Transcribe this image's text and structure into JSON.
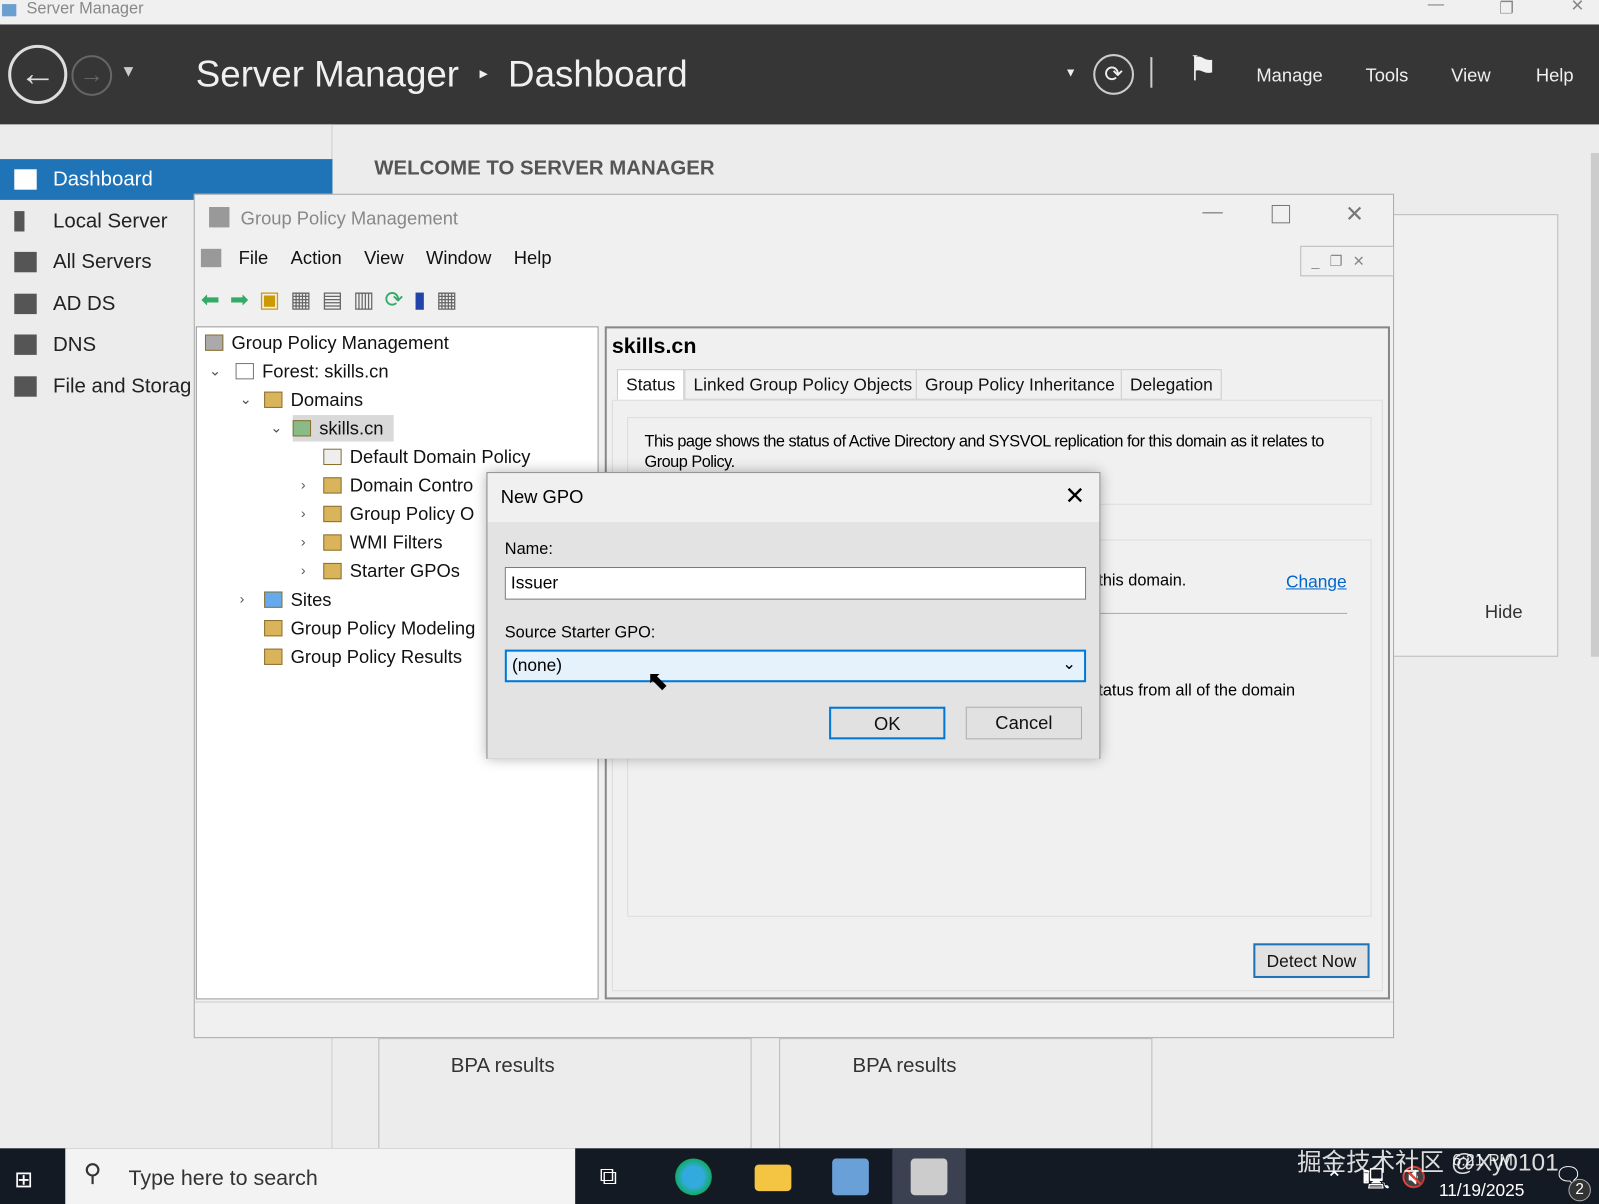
{
  "window": {
    "title": "Server Manager"
  },
  "header": {
    "breadcrumb_root": "Server Manager",
    "breadcrumb_sep": "▸",
    "breadcrumb_page": "Dashboard",
    "menu": [
      "Manage",
      "Tools",
      "View",
      "Help"
    ]
  },
  "sidebar": {
    "items": [
      {
        "label": "Dashboard",
        "active": true
      },
      {
        "label": "Local Server"
      },
      {
        "label": "All Servers"
      },
      {
        "label": "AD DS"
      },
      {
        "label": "DNS"
      },
      {
        "label": "File and Storag"
      }
    ]
  },
  "main": {
    "welcome": "WELCOME TO SERVER MANAGER",
    "hide": "Hide",
    "bpa1": "BPA results",
    "bpa2": "BPA results"
  },
  "gpm": {
    "title": "Group Policy Management",
    "menu": [
      "File",
      "Action",
      "View",
      "Window",
      "Help"
    ],
    "tree": [
      "Group Policy Management",
      "Forest: skills.cn",
      "Domains",
      "skills.cn",
      "Default Domain Policy",
      "Domain Contro",
      "Group Policy O",
      "WMI Filters",
      "Starter GPOs",
      "Sites",
      "Group Policy Modeling",
      "Group Policy Results"
    ],
    "pane_title": "skills.cn",
    "tabs": [
      "Status",
      "Linked Group Policy Objects",
      "Group Policy Inheritance",
      "Delegation"
    ],
    "status_text": "This page shows the status of Active Directory and SYSVOL replication for this domain as it relates to Group Policy.",
    "partial1": "this domain.",
    "change_link": "Change",
    "partial2": "tatus from all of the domain",
    "detect_now": "Detect Now"
  },
  "dialog": {
    "title": "New GPO",
    "name_label": "Name:",
    "name_value": "Issuer",
    "starter_label": "Source Starter GPO:",
    "starter_value": "(none)",
    "ok": "OK",
    "cancel": "Cancel"
  },
  "taskbar": {
    "search_placeholder": "Type here to search",
    "time": "6:21 PM",
    "date": "11/19/2025",
    "notifications": "2",
    "watermark": "掘金技术社区 @Xy0101"
  },
  "colors": {
    "accent": "#1f73b7",
    "header": "#363636",
    "taskbar": "#141a24",
    "link": "#0066cc"
  }
}
